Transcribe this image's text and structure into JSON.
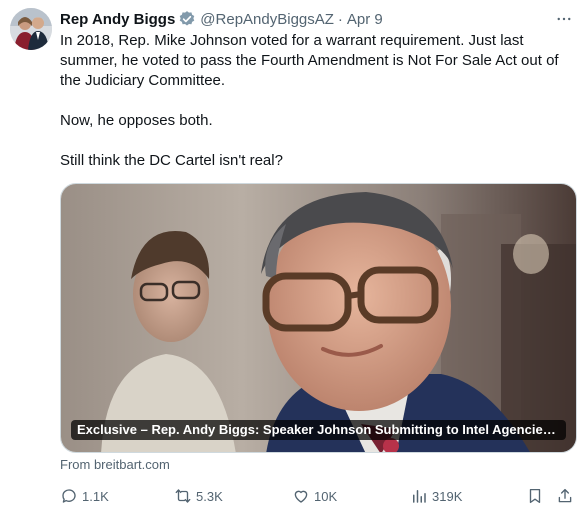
{
  "tweet": {
    "display_name": "Rep Andy Biggs",
    "handle": "@RepAndyBiggsAZ",
    "separator": "·",
    "date": "Apr 9",
    "paragraphs": [
      "In 2018, Rep. Mike Johnson voted for a warrant requirement. Just last summer, he voted to pass the Fourth Amendment is Not For Sale Act out of the Judiciary Committee.",
      "Now, he opposes both.",
      "Still think the DC Cartel isn't real?"
    ],
    "card": {
      "title": "Exclusive – Rep. Andy Biggs: Speaker Johnson Submitting to Intel Agencies on S..."
    },
    "source": "From breitbart.com"
  },
  "actions": {
    "reply_count": "1.1K",
    "repost_count": "5.3K",
    "like_count": "10K",
    "view_count": "319K"
  },
  "icons": {
    "verified": "verified-badge-icon",
    "more": "more-dots-icon",
    "reply": "reply-icon",
    "repost": "repost-icon",
    "like": "heart-icon",
    "views": "analytics-icon",
    "bookmark": "bookmark-icon",
    "share": "share-icon"
  },
  "colors": {
    "text": "#0f1419",
    "secondary": "#536471",
    "verified": "#829aab"
  }
}
